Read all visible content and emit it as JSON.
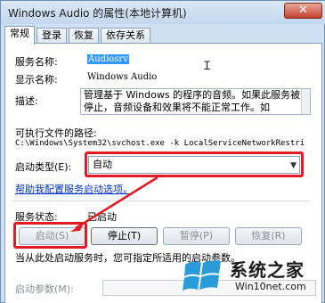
{
  "window": {
    "title": "Windows Audio 的属性(本地计算机)",
    "close_glyph": "✕"
  },
  "tabs": [
    {
      "label": "常规"
    },
    {
      "label": "登录"
    },
    {
      "label": "恢复"
    },
    {
      "label": "依存关系"
    }
  ],
  "general": {
    "service_name_label": "服务名称:",
    "service_name_value": "Audiosrv",
    "display_name_label": "显示名称:",
    "display_name_value": "Windows Audio",
    "description_label": "描述:",
    "description_text": "管理基于 Windows 的程序的音频。如果此服务被停止，音频设备和效果将不能正常工作。如",
    "path_label": "可执行文件的路径:",
    "path_value": "C:\\Windows\\System32\\svchost.exe -k LocalServiceNetworkRestri",
    "startup_type_label": "启动类型(E):",
    "startup_type_value": "自动",
    "help_link": "帮助我配置服务启动选项。",
    "status_label": "服务状态:",
    "status_value": "已启动",
    "buttons": {
      "start": "启动(S)",
      "stop": "停止(T)",
      "pause": "暂停(P)",
      "resume": "恢复(R)"
    },
    "start_hint": "当从此处启动服务时，您可指定所适用的启动参数。",
    "start_params_label": "启动参数(M):",
    "start_params_value": ""
  },
  "watermark": {
    "title": "系统之家",
    "url": "Win10net.com"
  },
  "colors": {
    "highlight": "#e41b23",
    "selection": "#3399ff",
    "link": "#0033cc"
  }
}
